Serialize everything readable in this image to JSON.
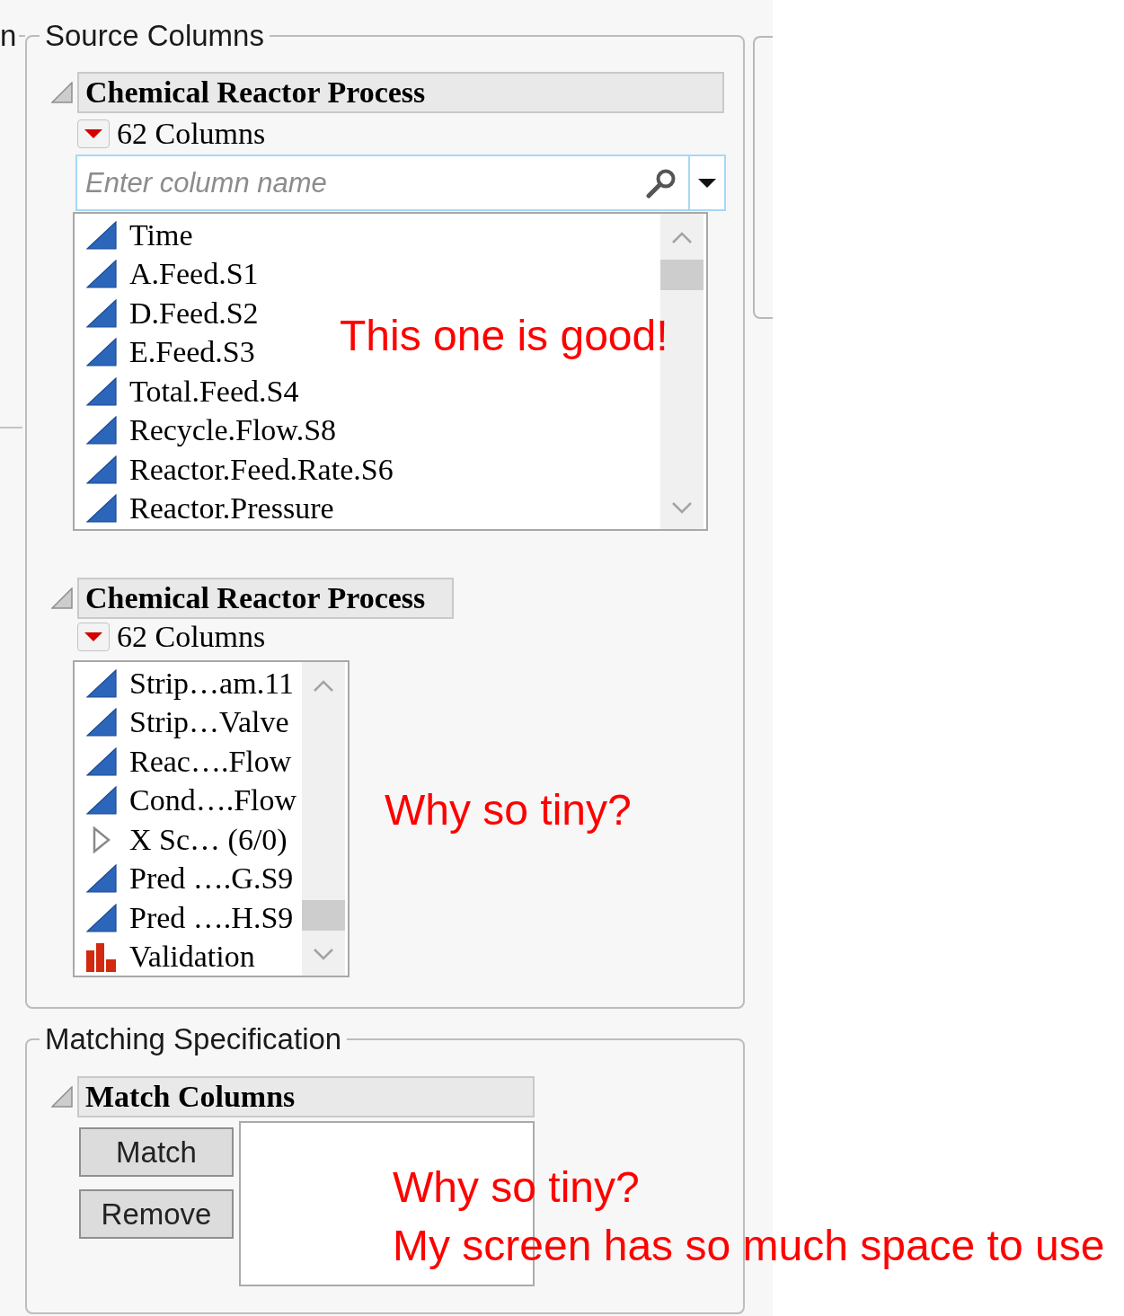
{
  "left_panel": {
    "title": "n"
  },
  "source_columns": {
    "title": "Source Columns",
    "tables": [
      {
        "name": "Chemical Reactor Process",
        "expanded": true,
        "column_count": "62 Columns",
        "search": {
          "placeholder": "Enter column name"
        },
        "columns": [
          {
            "name": "Time",
            "kind": "continuous"
          },
          {
            "name": "A.Feed.S1",
            "kind": "continuous"
          },
          {
            "name": "D.Feed.S2",
            "kind": "continuous"
          },
          {
            "name": "E.Feed.S3",
            "kind": "continuous"
          },
          {
            "name": "Total.Feed.S4",
            "kind": "continuous"
          },
          {
            "name": "Recycle.Flow.S8",
            "kind": "continuous"
          },
          {
            "name": "Reactor.Feed.Rate.S6",
            "kind": "continuous"
          },
          {
            "name": "Reactor.Pressure",
            "kind": "continuous"
          }
        ]
      },
      {
        "name": "Chemical Reactor Process",
        "expanded": true,
        "column_count": "62 Columns",
        "columns": [
          {
            "name": "Strip…am.11",
            "kind": "continuous"
          },
          {
            "name": "Strip…Valve",
            "kind": "continuous"
          },
          {
            "name": "Reac….Flow",
            "kind": "continuous"
          },
          {
            "name": "Cond….Flow",
            "kind": "continuous"
          },
          {
            "name": "X Sc… (6/0)",
            "kind": "group"
          },
          {
            "name": "Pred ….G.S9",
            "kind": "continuous"
          },
          {
            "name": "Pred ….H.S9",
            "kind": "continuous"
          },
          {
            "name": "Validation",
            "kind": "nominal"
          }
        ]
      }
    ]
  },
  "matching_specification": {
    "title": "Matching Specification",
    "outline": {
      "title": "Match Columns",
      "expanded": true
    },
    "buttons": [
      "Match",
      "Remove"
    ]
  },
  "annotations": [
    {
      "lines": [
        "This one is good!"
      ]
    },
    {
      "lines": [
        "Why so tiny?"
      ]
    },
    {
      "lines": [
        "Why so tiny?",
        "My screen has so much space to use"
      ]
    }
  ]
}
